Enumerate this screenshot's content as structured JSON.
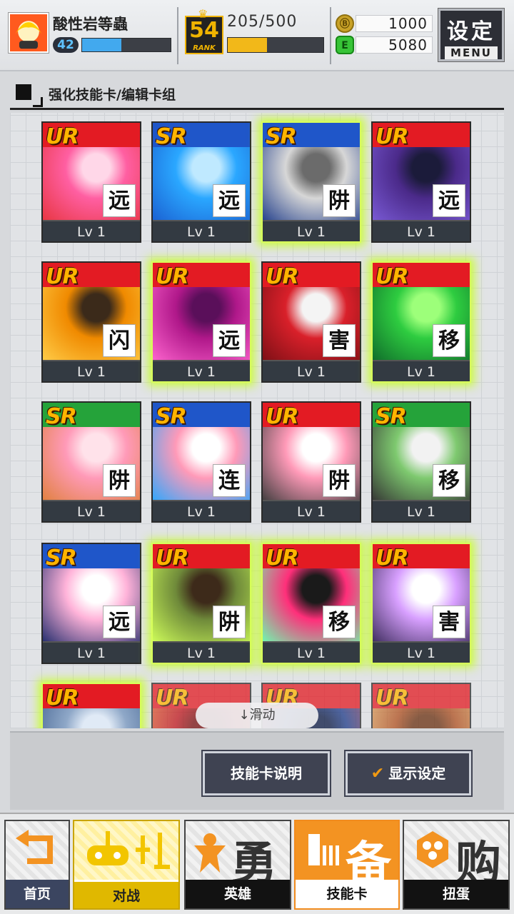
{
  "player": {
    "name": "酸性岩等蟲",
    "level": "42",
    "xp_fraction": 0.44
  },
  "rank": {
    "number": "54",
    "word": "RANK",
    "crown": "♛"
  },
  "stamina": {
    "text": "205/500",
    "fraction": 0.41
  },
  "currency": {
    "gold_icon": "Ⓑ",
    "gold": "1000",
    "gem_icon": "E",
    "gems": "5080"
  },
  "settings": {
    "label": "设定",
    "sub": "MENU"
  },
  "section": {
    "title": "强化技能卡/编辑卡组"
  },
  "cards": [
    {
      "rarity": "UR",
      "type": "远",
      "level": "Lv 1",
      "glow": false
    },
    {
      "rarity": "SR",
      "type": "远",
      "level": "Lv 1",
      "glow": false
    },
    {
      "rarity": "SR",
      "type": "阱",
      "level": "Lv 1",
      "glow": true
    },
    {
      "rarity": "UR",
      "type": "远",
      "level": "Lv 1",
      "glow": false
    },
    {
      "rarity": "UR",
      "type": "闪",
      "level": "Lv 1",
      "glow": false
    },
    {
      "rarity": "UR",
      "type": "远",
      "level": "Lv 1",
      "glow": true
    },
    {
      "rarity": "UR",
      "type": "害",
      "level": "Lv 1",
      "glow": false
    },
    {
      "rarity": "UR",
      "type": "移",
      "level": "Lv 1",
      "glow": true
    },
    {
      "rarity": "SR",
      "type": "阱",
      "level": "Lv 1",
      "glow": false
    },
    {
      "rarity": "SR",
      "type": "连",
      "level": "Lv 1",
      "glow": false
    },
    {
      "rarity": "UR",
      "type": "阱",
      "level": "Lv 1",
      "glow": false
    },
    {
      "rarity": "SR",
      "type": "移",
      "level": "Lv 1",
      "glow": false
    },
    {
      "rarity": "SR",
      "type": "远",
      "level": "Lv 1",
      "glow": false
    },
    {
      "rarity": "UR",
      "type": "阱",
      "level": "Lv 1",
      "glow": true
    },
    {
      "rarity": "UR",
      "type": "移",
      "level": "Lv 1",
      "glow": true
    },
    {
      "rarity": "UR",
      "type": "害",
      "level": "Lv 1",
      "glow": true
    },
    {
      "rarity": "UR",
      "type": "",
      "level": "",
      "glow": true
    },
    {
      "rarity": "UR",
      "type": "",
      "level": "",
      "glow": false
    },
    {
      "rarity": "UR",
      "type": "",
      "level": "",
      "glow": false
    },
    {
      "rarity": "UR",
      "type": "",
      "level": "",
      "glow": false
    }
  ],
  "scroll_hint": "↓滑动",
  "actions": {
    "help": "技能卡说明",
    "display_check": "✔",
    "display": "显示设定"
  },
  "nav": {
    "home": "首页",
    "battle": "对战",
    "hero": "英雄",
    "hero_glyph": "勇",
    "cards": "技能卡",
    "cards_glyph": "备",
    "gacha": "扭蛋",
    "gacha_glyph": "购"
  }
}
